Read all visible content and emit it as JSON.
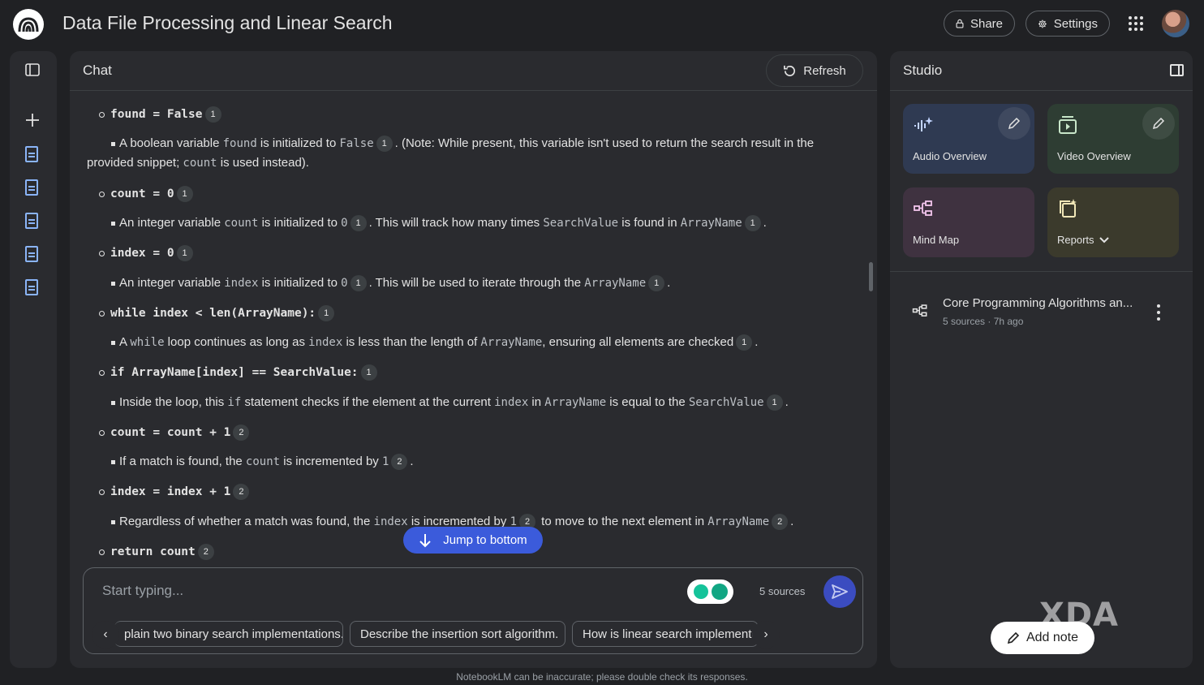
{
  "header": {
    "title": "Data File Processing and Linear Search",
    "share_label": "Share",
    "settings_label": "Settings"
  },
  "chat": {
    "title": "Chat",
    "refresh_label": "Refresh",
    "lines": {
      "l1": {
        "code": "found = False",
        "cite": "1"
      },
      "l2": {
        "t1": "A boolean variable ",
        "c1": "found",
        "t2": " is initialized to ",
        "c2": "False",
        "cite": "1",
        "t3": ". (Note: While present, this variable isn't used to return the search result in the"
      },
      "l3": {
        "t1": "provided snippet; ",
        "c1": "count",
        "t2": " is used instead)."
      },
      "l4": {
        "code": "count = 0",
        "cite": "1"
      },
      "l5": {
        "t1": "An integer variable ",
        "c1": "count",
        "t2": " is initialized to ",
        "c2": "0",
        "cite1": "1",
        "t3": ". This will track how many times ",
        "c3": "SearchValue",
        "t4": " is found in ",
        "c4": "ArrayName",
        "cite2": "1",
        "t5": "."
      },
      "l6": {
        "code": "index = 0",
        "cite": "1"
      },
      "l7": {
        "t1": "An integer variable ",
        "c1": "index",
        "t2": " is initialized to ",
        "c2": "0",
        "cite1": "1",
        "t3": ". This will be used to iterate through the ",
        "c3": "ArrayName",
        "cite2": "1",
        "t4": "."
      },
      "l8": {
        "code": "while index < len(ArrayName):",
        "cite": "1"
      },
      "l9": {
        "t1": "A ",
        "c1": "while",
        "t2": " loop continues as long as ",
        "c2": "index",
        "t3": " is less than the length of ",
        "c3": "ArrayName",
        "t4": ", ensuring all elements are checked",
        "cite": "1",
        "t5": "."
      },
      "l10": {
        "code": "if ArrayName[index] == SearchValue:",
        "cite": "1"
      },
      "l11": {
        "t1": "Inside the loop, this ",
        "c1": "if",
        "t2": " statement checks if the element at the current ",
        "c2": "index",
        "t3": " in ",
        "c3": "ArrayName",
        "t4": " is equal to the ",
        "c4": "SearchValue",
        "cite": "1",
        "t5": "."
      },
      "l12": {
        "code": "count = count + 1",
        "cite": "2"
      },
      "l13": {
        "t1": "If a match is found, the ",
        "c1": "count",
        "t2": " is incremented by ",
        "c2": "1",
        "cite": "2",
        "t3": "."
      },
      "l14": {
        "code": "index = index + 1",
        "cite": "2"
      },
      "l15": {
        "t1": "Regardless of whether a match was found, the ",
        "c1": "index",
        "t2": " is incremented by ",
        "c2": "1",
        "cite1": "2",
        "t3": " to move to the next element in ",
        "c3": "ArrayName",
        "cite2": "2",
        "t4": "."
      },
      "l16": {
        "code": "return count",
        "cite": "2"
      }
    },
    "jump_label": "Jump to bottom",
    "composer_placeholder": "Start typing...",
    "sources_count": "5 sources",
    "suggestions": [
      "plain two binary search implementations.",
      "Describe the insertion sort algorithm.",
      "How is linear search implemente"
    ],
    "footer_note": "NotebookLM can be inaccurate; please double check its responses."
  },
  "studio": {
    "title": "Studio",
    "cards": {
      "audio": {
        "label": "Audio Overview",
        "bg": "#2f3a52",
        "accent": "#c2d4ff"
      },
      "video": {
        "label": "Video Overview",
        "bg": "#2e3d33",
        "accent": "#c8e6c9"
      },
      "mindmap": {
        "label": "Mind Map",
        "bg": "#3f3240",
        "accent": "#f4c6ee"
      },
      "reports": {
        "label": "Reports",
        "bg": "#3b3a2c",
        "accent": "#f1e7b8"
      }
    },
    "note": {
      "title": "Core Programming Algorithms an...",
      "meta": "5 sources · 7h ago"
    },
    "add_note_label": "Add note",
    "watermark": "XDA"
  },
  "icons": [
    "notebooklm-logo-icon",
    "lock-icon",
    "gear-icon",
    "apps-grid-icon",
    "sidebar-toggle-icon",
    "plus-icon",
    "document-icon",
    "refresh-icon",
    "arrow-down-icon",
    "send-icon",
    "chevron-left-icon",
    "chevron-right-icon",
    "audio-sparkle-icon",
    "video-icon",
    "mind-map-icon",
    "reports-icon",
    "pencil-icon",
    "kebab-menu-icon"
  ]
}
